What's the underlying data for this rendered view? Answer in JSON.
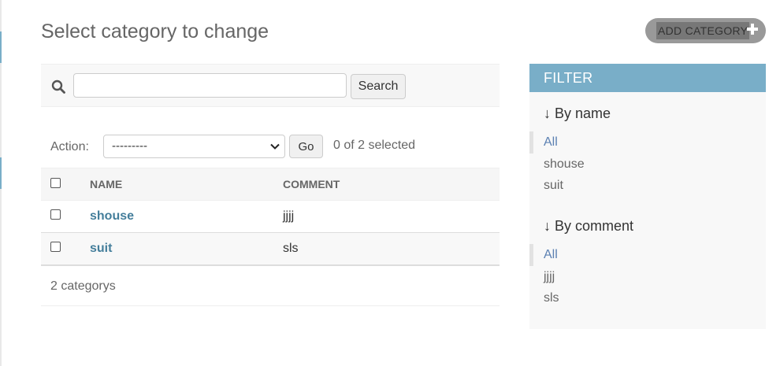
{
  "page": {
    "title": "Select category to change"
  },
  "header": {
    "add_button_label": "ADD CATEGORY"
  },
  "search": {
    "value": "",
    "placeholder": "",
    "button_label": "Search"
  },
  "actions": {
    "label": "Action:",
    "selected_option": "---------",
    "go_label": "Go",
    "selected_text": "0 of 2 selected"
  },
  "table": {
    "columns": [
      "NAME",
      "COMMENT"
    ],
    "rows": [
      {
        "name": "shouse",
        "comment": "jjjj"
      },
      {
        "name": "suit",
        "comment": "sls"
      }
    ]
  },
  "paginator": {
    "text": "2 categorys"
  },
  "filter": {
    "title": "FILTER",
    "groups": [
      {
        "heading": "↓ By name",
        "items": [
          "All",
          "shouse",
          "suit"
        ],
        "selected": "All"
      },
      {
        "heading": "↓ By comment",
        "items": [
          "All",
          "jjjj",
          "sls"
        ],
        "selected": "All"
      }
    ]
  },
  "colors": {
    "accent": "#79aec8",
    "link": "#447e9b",
    "filter_selected": "#5b80b2"
  },
  "icons": {
    "search": "search-icon",
    "add": "plus-icon",
    "select": "chevron-down-icon"
  }
}
